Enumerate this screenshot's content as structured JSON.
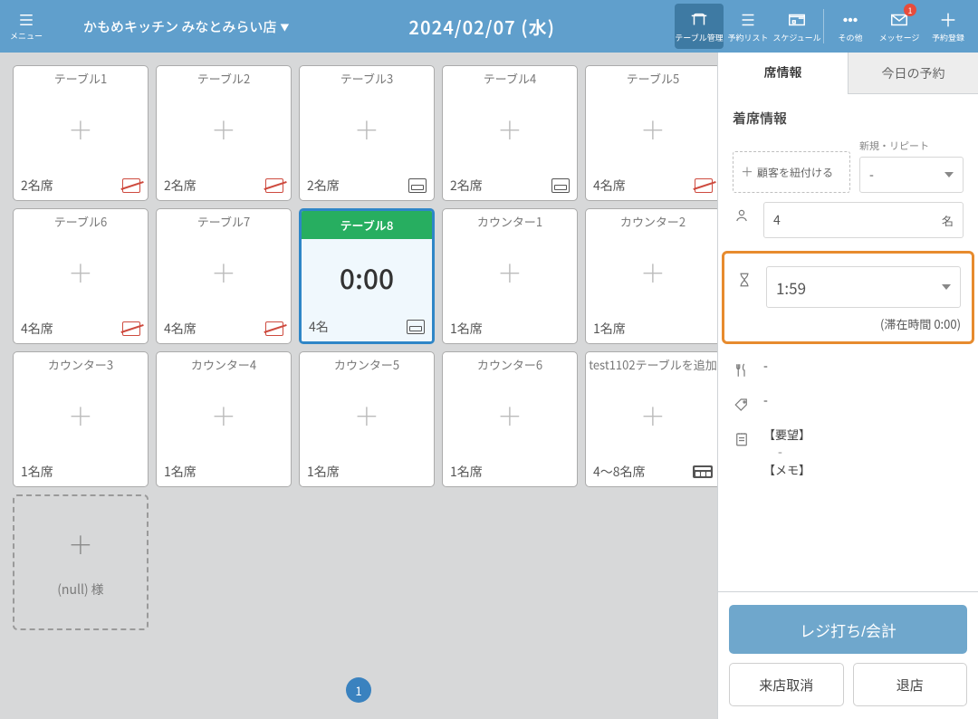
{
  "header": {
    "menu_label": "メニュー",
    "store_name": "かもめキッチン みなとみらい店",
    "date": "2024/02/07 (水)",
    "nav": {
      "table": "テーブル管理",
      "list": "予約リスト",
      "schedule": "スケジュール",
      "other": "その他",
      "message": "メッセージ",
      "message_badge": "1",
      "add": "予約登録"
    }
  },
  "tables": [
    {
      "name": "テーブル1",
      "seats": "2名席",
      "icon": "nosmoke"
    },
    {
      "name": "テーブル2",
      "seats": "2名席",
      "icon": "nosmoke"
    },
    {
      "name": "テーブル3",
      "seats": "2名席",
      "icon": "seat"
    },
    {
      "name": "テーブル4",
      "seats": "2名席",
      "icon": "seat"
    },
    {
      "name": "テーブル5",
      "seats": "4名席",
      "icon": "nosmoke"
    },
    {
      "name": "テーブル6",
      "seats": "4名席",
      "icon": "nosmoke"
    },
    {
      "name": "テーブル7",
      "seats": "4名席",
      "icon": "nosmoke"
    },
    {
      "name": "テーブル8",
      "seats_sel": "4名",
      "time": "0:00",
      "icon": "seat",
      "selected": true
    },
    {
      "name": "カウンター1",
      "seats": "1名席"
    },
    {
      "name": "カウンター2",
      "seats": "1名席"
    },
    {
      "name": "カウンター3",
      "seats": "1名席"
    },
    {
      "name": "カウンター4",
      "seats": "1名席"
    },
    {
      "name": "カウンター5",
      "seats": "1名席"
    },
    {
      "name": "カウンター6",
      "seats": "1名席"
    },
    {
      "name": "test1102テーブルを追加",
      "seats": "4～8名席",
      "icon": "seatb"
    }
  ],
  "waiting_label": "(null) 様",
  "page": "1",
  "side": {
    "tab_info": "席情報",
    "tab_today": "今日の予約",
    "section_title": "着席情報",
    "link_customer": "顧客を紐付ける",
    "repeat_label": "新規・リピート",
    "repeat_value": "-",
    "party_value": "4",
    "party_suffix": "名",
    "stay_value": "1:59",
    "stay_note": "(滞在時間 0:00)",
    "course_value": "-",
    "tag_value": "-",
    "req_label": "【要望】",
    "req_value": "-",
    "memo_label": "【メモ】",
    "btn_primary": "レジ打ち/会計",
    "btn_cancel": "来店取消",
    "btn_close": "退店"
  }
}
